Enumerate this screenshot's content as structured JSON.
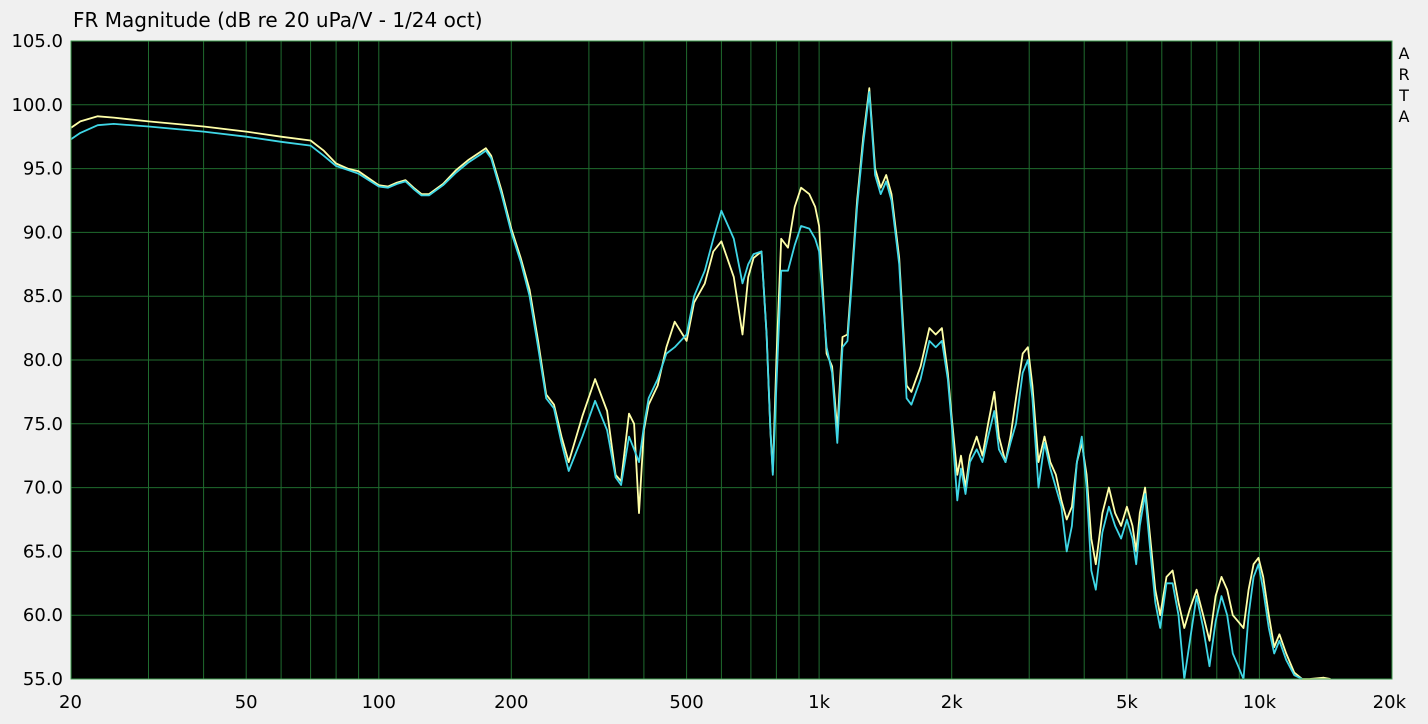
{
  "chart_data": {
    "type": "line",
    "title": "FR Magnitude (dB re 20 uPa/V - 1/24 oct)",
    "xlabel": "",
    "ylabel": "",
    "x_scale": "log",
    "xlim": [
      20,
      20000
    ],
    "ylim": [
      55.0,
      105.0
    ],
    "grid": true,
    "y_ticks": [
      "105.0",
      "100.0",
      "95.0",
      "90.0",
      "85.0",
      "80.0",
      "75.0",
      "70.0",
      "65.0",
      "60.0",
      "55.0"
    ],
    "x_ticks": [
      {
        "value": 20,
        "label": "20"
      },
      {
        "value": 50,
        "label": "50"
      },
      {
        "value": 100,
        "label": "100"
      },
      {
        "value": 200,
        "label": "200"
      },
      {
        "value": 500,
        "label": "500"
      },
      {
        "value": 1000,
        "label": "1k"
      },
      {
        "value": 2000,
        "label": "2k"
      },
      {
        "value": 5000,
        "label": "5k"
      },
      {
        "value": 10000,
        "label": "10k"
      },
      {
        "value": 20000,
        "label": "20k"
      }
    ],
    "watermark": "ARTA",
    "colors": {
      "background": "#000000",
      "grid": "#1f6b2e",
      "frame": "#3c9a4c"
    },
    "series": [
      {
        "color": "#ffffa8",
        "points": [
          [
            20,
            98.2
          ],
          [
            21,
            98.7
          ],
          [
            23,
            99.1
          ],
          [
            25,
            99.0
          ],
          [
            30,
            98.7
          ],
          [
            40,
            98.3
          ],
          [
            50,
            97.9
          ],
          [
            60,
            97.5
          ],
          [
            70,
            97.2
          ],
          [
            75,
            96.4
          ],
          [
            80,
            95.4
          ],
          [
            85,
            95.0
          ],
          [
            90,
            94.8
          ],
          [
            100,
            93.7
          ],
          [
            105,
            93.6
          ],
          [
            110,
            93.9
          ],
          [
            115,
            94.1
          ],
          [
            120,
            93.5
          ],
          [
            125,
            93.0
          ],
          [
            130,
            93.0
          ],
          [
            140,
            93.8
          ],
          [
            150,
            94.9
          ],
          [
            160,
            95.7
          ],
          [
            170,
            96.3
          ],
          [
            175,
            96.6
          ],
          [
            180,
            96.0
          ],
          [
            190,
            93.3
          ],
          [
            200,
            90.3
          ],
          [
            210,
            88.0
          ],
          [
            220,
            85.5
          ],
          [
            230,
            81.5
          ],
          [
            240,
            77.3
          ],
          [
            250,
            76.5
          ],
          [
            260,
            74.0
          ],
          [
            270,
            72.0
          ],
          [
            290,
            75.6
          ],
          [
            310,
            78.5
          ],
          [
            330,
            76.0
          ],
          [
            345,
            71.0
          ],
          [
            355,
            70.5
          ],
          [
            370,
            75.8
          ],
          [
            380,
            75.0
          ],
          [
            390,
            68.0
          ],
          [
            400,
            74.5
          ],
          [
            410,
            76.5
          ],
          [
            430,
            78.0
          ],
          [
            450,
            81.0
          ],
          [
            470,
            83.0
          ],
          [
            500,
            81.5
          ],
          [
            520,
            84.5
          ],
          [
            550,
            86.0
          ],
          [
            575,
            88.5
          ],
          [
            600,
            89.3
          ],
          [
            640,
            86.5
          ],
          [
            670,
            82.0
          ],
          [
            690,
            86.5
          ],
          [
            710,
            88.0
          ],
          [
            740,
            88.5
          ],
          [
            760,
            82.0
          ],
          [
            775,
            74.5
          ],
          [
            785,
            71.2
          ],
          [
            800,
            80.0
          ],
          [
            820,
            89.5
          ],
          [
            850,
            88.8
          ],
          [
            880,
            92.0
          ],
          [
            910,
            93.5
          ],
          [
            950,
            93.0
          ],
          [
            980,
            92.0
          ],
          [
            1000,
            90.5
          ],
          [
            1040,
            80.5
          ],
          [
            1070,
            79.5
          ],
          [
            1100,
            74.5
          ],
          [
            1130,
            81.8
          ],
          [
            1160,
            82.0
          ],
          [
            1180,
            85.5
          ],
          [
            1220,
            92.5
          ],
          [
            1260,
            97.5
          ],
          [
            1300,
            101.3
          ],
          [
            1340,
            95.0
          ],
          [
            1380,
            93.5
          ],
          [
            1420,
            94.5
          ],
          [
            1460,
            93.0
          ],
          [
            1520,
            88.0
          ],
          [
            1580,
            78.0
          ],
          [
            1620,
            77.5
          ],
          [
            1700,
            79.5
          ],
          [
            1780,
            82.5
          ],
          [
            1840,
            82.0
          ],
          [
            1900,
            82.5
          ],
          [
            1960,
            79.0
          ],
          [
            2000,
            75.5
          ],
          [
            2060,
            71.0
          ],
          [
            2100,
            72.5
          ],
          [
            2150,
            70.0
          ],
          [
            2200,
            72.5
          ],
          [
            2280,
            74.0
          ],
          [
            2350,
            72.5
          ],
          [
            2420,
            75.0
          ],
          [
            2500,
            77.5
          ],
          [
            2560,
            74.0
          ],
          [
            2650,
            72.0
          ],
          [
            2720,
            74.0
          ],
          [
            2800,
            77.0
          ],
          [
            2900,
            80.5
          ],
          [
            2980,
            81.0
          ],
          [
            3050,
            78.0
          ],
          [
            3150,
            72.0
          ],
          [
            3250,
            74.0
          ],
          [
            3350,
            72.0
          ],
          [
            3450,
            71.0
          ],
          [
            3550,
            69.0
          ],
          [
            3650,
            67.5
          ],
          [
            3750,
            68.5
          ],
          [
            3850,
            72.0
          ],
          [
            3950,
            73.5
          ],
          [
            4050,
            71.0
          ],
          [
            4150,
            66.0
          ],
          [
            4250,
            64.0
          ],
          [
            4400,
            68.0
          ],
          [
            4550,
            70.0
          ],
          [
            4700,
            68.0
          ],
          [
            4850,
            67.0
          ],
          [
            5000,
            68.5
          ],
          [
            5150,
            67.0
          ],
          [
            5250,
            65.0
          ],
          [
            5350,
            68.0
          ],
          [
            5500,
            70.0
          ],
          [
            5650,
            66.0
          ],
          [
            5800,
            62.0
          ],
          [
            5950,
            60.0
          ],
          [
            6150,
            63.0
          ],
          [
            6350,
            63.5
          ],
          [
            6550,
            61.0
          ],
          [
            6750,
            59.0
          ],
          [
            6950,
            60.5
          ],
          [
            7200,
            62.0
          ],
          [
            7450,
            60.0
          ],
          [
            7700,
            58.0
          ],
          [
            7950,
            61.5
          ],
          [
            8200,
            63.0
          ],
          [
            8450,
            62.0
          ],
          [
            8700,
            60.0
          ],
          [
            8950,
            59.5
          ],
          [
            9200,
            59.0
          ],
          [
            9450,
            62.0
          ],
          [
            9700,
            64.0
          ],
          [
            9950,
            64.5
          ],
          [
            10200,
            63.0
          ],
          [
            10500,
            60.0
          ],
          [
            10800,
            57.5
          ],
          [
            11100,
            58.5
          ],
          [
            11500,
            57.0
          ],
          [
            12000,
            55.5
          ],
          [
            12500,
            55.0
          ],
          [
            13000,
            55.0
          ],
          [
            14000,
            55.1
          ],
          [
            14500,
            55.0
          ]
        ]
      },
      {
        "color": "#3fd6e6",
        "points": [
          [
            20,
            97.3
          ],
          [
            21,
            97.8
          ],
          [
            23,
            98.4
          ],
          [
            25,
            98.5
          ],
          [
            30,
            98.3
          ],
          [
            40,
            97.9
          ],
          [
            50,
            97.5
          ],
          [
            60,
            97.1
          ],
          [
            70,
            96.8
          ],
          [
            75,
            96.0
          ],
          [
            80,
            95.2
          ],
          [
            85,
            94.9
          ],
          [
            90,
            94.6
          ],
          [
            100,
            93.6
          ],
          [
            105,
            93.5
          ],
          [
            110,
            93.8
          ],
          [
            115,
            94.0
          ],
          [
            120,
            93.4
          ],
          [
            125,
            92.9
          ],
          [
            130,
            92.9
          ],
          [
            140,
            93.7
          ],
          [
            150,
            94.7
          ],
          [
            160,
            95.5
          ],
          [
            170,
            96.1
          ],
          [
            175,
            96.4
          ],
          [
            180,
            95.8
          ],
          [
            190,
            93.0
          ],
          [
            200,
            90.0
          ],
          [
            210,
            87.7
          ],
          [
            220,
            85.0
          ],
          [
            230,
            81.0
          ],
          [
            240,
            77.0
          ],
          [
            250,
            76.2
          ],
          [
            260,
            73.5
          ],
          [
            270,
            71.3
          ],
          [
            290,
            74.0
          ],
          [
            310,
            76.8
          ],
          [
            330,
            74.5
          ],
          [
            345,
            70.8
          ],
          [
            355,
            70.2
          ],
          [
            370,
            74.0
          ],
          [
            380,
            73.0
          ],
          [
            390,
            72.0
          ],
          [
            400,
            74.8
          ],
          [
            410,
            77.0
          ],
          [
            430,
            78.5
          ],
          [
            450,
            80.5
          ],
          [
            470,
            81.0
          ],
          [
            500,
            82.0
          ],
          [
            520,
            85.0
          ],
          [
            550,
            87.0
          ],
          [
            575,
            89.5
          ],
          [
            600,
            91.7
          ],
          [
            640,
            89.5
          ],
          [
            670,
            86.0
          ],
          [
            690,
            87.5
          ],
          [
            710,
            88.3
          ],
          [
            740,
            88.5
          ],
          [
            760,
            82.0
          ],
          [
            775,
            74.5
          ],
          [
            785,
            71.0
          ],
          [
            800,
            78.0
          ],
          [
            820,
            87.0
          ],
          [
            850,
            87.0
          ],
          [
            880,
            89.0
          ],
          [
            910,
            90.5
          ],
          [
            950,
            90.3
          ],
          [
            980,
            89.5
          ],
          [
            1000,
            88.5
          ],
          [
            1040,
            81.0
          ],
          [
            1070,
            79.0
          ],
          [
            1100,
            73.5
          ],
          [
            1130,
            81.0
          ],
          [
            1160,
            81.5
          ],
          [
            1180,
            85.0
          ],
          [
            1220,
            92.0
          ],
          [
            1260,
            97.0
          ],
          [
            1300,
            101.0
          ],
          [
            1340,
            94.5
          ],
          [
            1380,
            93.0
          ],
          [
            1420,
            94.0
          ],
          [
            1460,
            92.5
          ],
          [
            1520,
            87.5
          ],
          [
            1580,
            77.0
          ],
          [
            1620,
            76.5
          ],
          [
            1700,
            78.5
          ],
          [
            1780,
            81.5
          ],
          [
            1840,
            81.0
          ],
          [
            1900,
            81.5
          ],
          [
            1960,
            78.5
          ],
          [
            2000,
            75.0
          ],
          [
            2060,
            69.0
          ],
          [
            2100,
            71.5
          ],
          [
            2150,
            69.5
          ],
          [
            2200,
            72.0
          ],
          [
            2280,
            73.0
          ],
          [
            2350,
            72.0
          ],
          [
            2420,
            74.0
          ],
          [
            2500,
            76.0
          ],
          [
            2560,
            73.0
          ],
          [
            2650,
            72.0
          ],
          [
            2720,
            73.5
          ],
          [
            2800,
            75.0
          ],
          [
            2900,
            79.0
          ],
          [
            2980,
            80.0
          ],
          [
            3050,
            77.0
          ],
          [
            3150,
            70.0
          ],
          [
            3250,
            73.5
          ],
          [
            3350,
            71.5
          ],
          [
            3450,
            70.0
          ],
          [
            3550,
            68.5
          ],
          [
            3650,
            65.0
          ],
          [
            3750,
            67.0
          ],
          [
            3850,
            72.0
          ],
          [
            3950,
            74.0
          ],
          [
            4050,
            70.0
          ],
          [
            4150,
            63.5
          ],
          [
            4250,
            62.0
          ],
          [
            4400,
            66.5
          ],
          [
            4550,
            68.5
          ],
          [
            4700,
            67.0
          ],
          [
            4850,
            66.0
          ],
          [
            5000,
            67.5
          ],
          [
            5150,
            66.0
          ],
          [
            5250,
            64.0
          ],
          [
            5350,
            67.0
          ],
          [
            5500,
            69.5
          ],
          [
            5650,
            65.0
          ],
          [
            5800,
            61.0
          ],
          [
            5950,
            59.0
          ],
          [
            6150,
            62.5
          ],
          [
            6350,
            62.5
          ],
          [
            6550,
            60.0
          ],
          [
            6750,
            55.0
          ],
          [
            6950,
            58.0
          ],
          [
            7200,
            61.5
          ],
          [
            7450,
            59.0
          ],
          [
            7700,
            56.0
          ],
          [
            7950,
            59.5
          ],
          [
            8200,
            61.5
          ],
          [
            8450,
            60.0
          ],
          [
            8700,
            57.0
          ],
          [
            8950,
            56.0
          ],
          [
            9200,
            55.0
          ],
          [
            9450,
            60.0
          ],
          [
            9700,
            63.0
          ],
          [
            9950,
            64.0
          ],
          [
            10200,
            62.0
          ],
          [
            10500,
            59.0
          ],
          [
            10800,
            57.0
          ],
          [
            11100,
            58.0
          ],
          [
            11500,
            56.5
          ],
          [
            12000,
            55.3
          ],
          [
            12500,
            55.0
          ]
        ]
      }
    ]
  }
}
